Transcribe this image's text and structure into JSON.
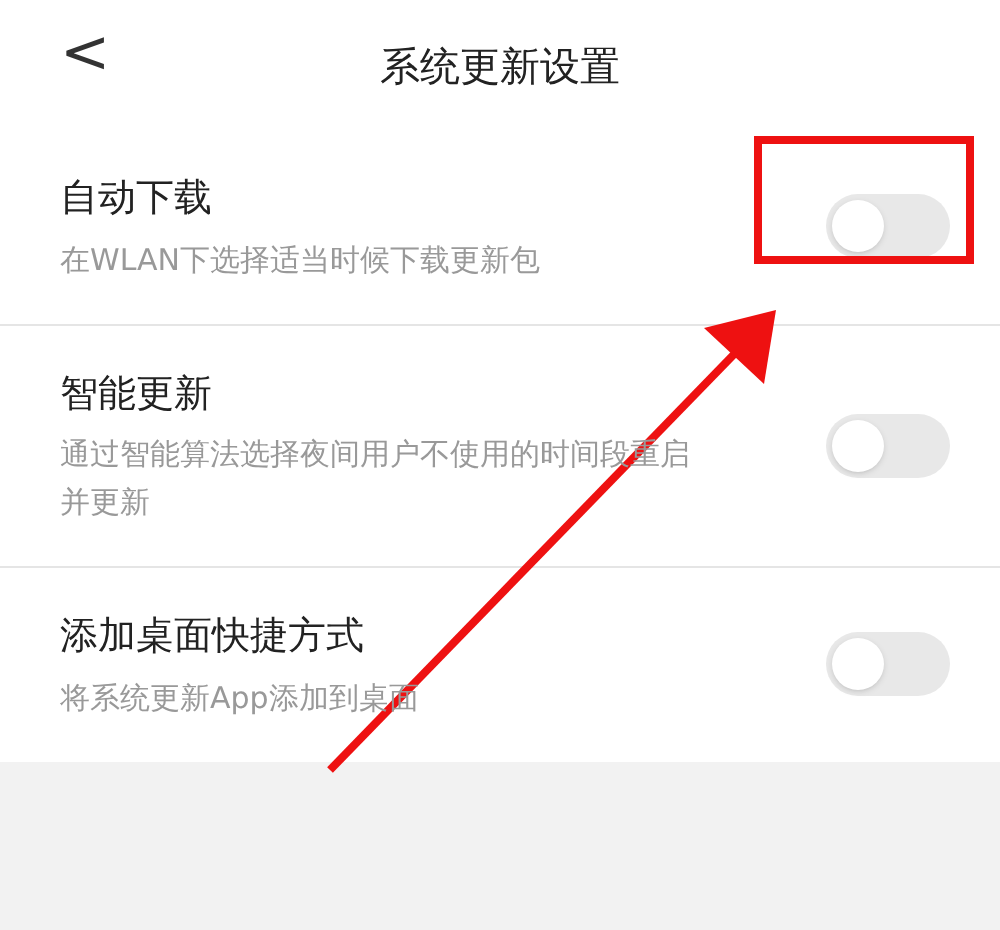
{
  "header": {
    "back": "<",
    "title": "系统更新设置"
  },
  "settings": [
    {
      "title": "自动下载",
      "description": "在WLAN下选择适当时候下载更新包",
      "on": false
    },
    {
      "title": "智能更新",
      "description": "通过智能算法选择夜间用户不使用的时间段重启并更新",
      "on": false
    },
    {
      "title": "添加桌面快捷方式",
      "description": "将系统更新App添加到桌面",
      "on": false
    }
  ]
}
